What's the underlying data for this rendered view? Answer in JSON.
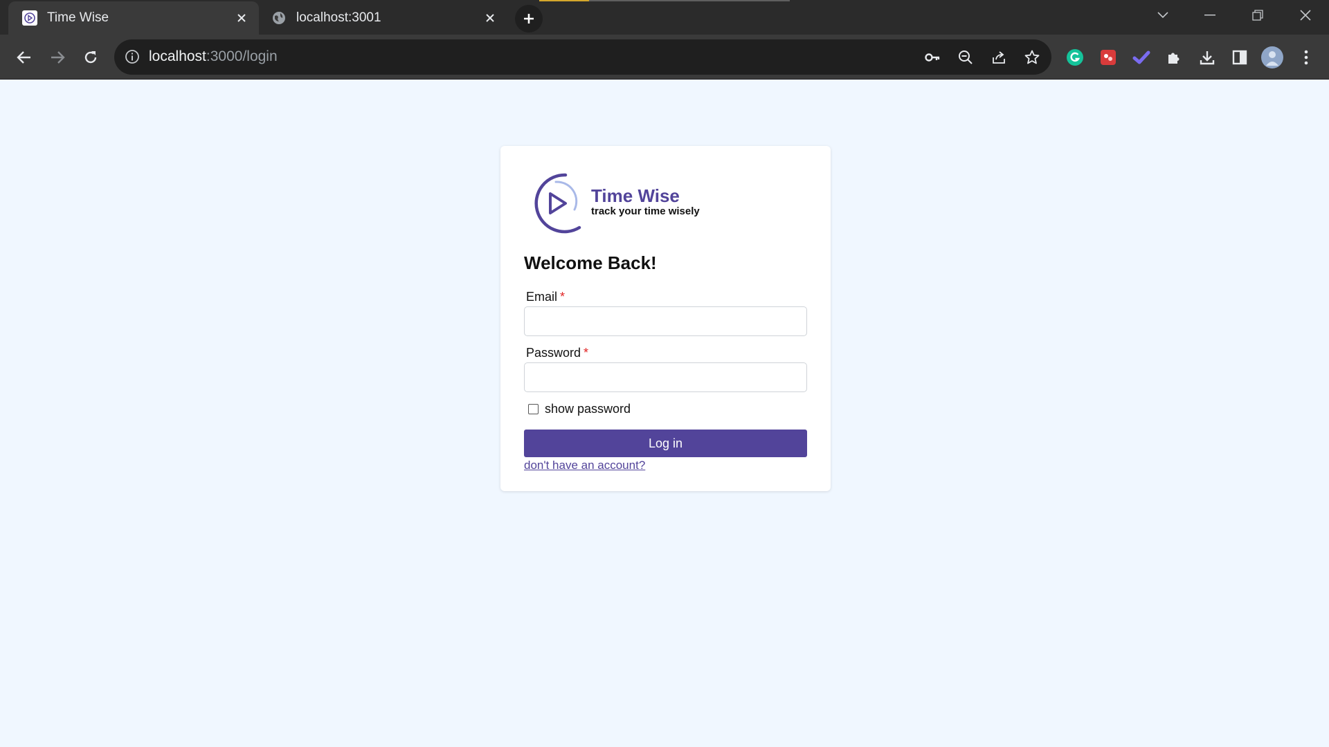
{
  "browser": {
    "tabs": [
      {
        "title": "Time Wise",
        "favicon": "timewise-play-icon",
        "active": true
      },
      {
        "title": "localhost:3001",
        "favicon": "globe-icon",
        "active": false
      }
    ],
    "url": {
      "host": "localhost",
      "path": ":3000/login"
    },
    "omnibox_actions": [
      "key-icon",
      "zoom-out-icon",
      "share-icon",
      "star-icon"
    ],
    "extensions": [
      "grammarly-icon",
      "red-extension-icon",
      "checkmark-extension-icon",
      "puzzle-icon",
      "download-icon",
      "sidepanel-icon",
      "profile-avatar",
      "menu-icon"
    ]
  },
  "brand": {
    "name": "Time Wise",
    "tagline": "track your time wisely",
    "color": "#52449a"
  },
  "login": {
    "heading": "Welcome Back!",
    "email_label": "Email",
    "password_label": "Password",
    "required_marker": "*",
    "email_value": "",
    "password_value": "",
    "show_password_label": "show password",
    "show_password_checked": false,
    "submit_label": "Log in",
    "signup_link": "don't have an account?"
  },
  "colors": {
    "page_background": "#f0f7ff",
    "button": "#52449a",
    "required": "#e02424"
  }
}
